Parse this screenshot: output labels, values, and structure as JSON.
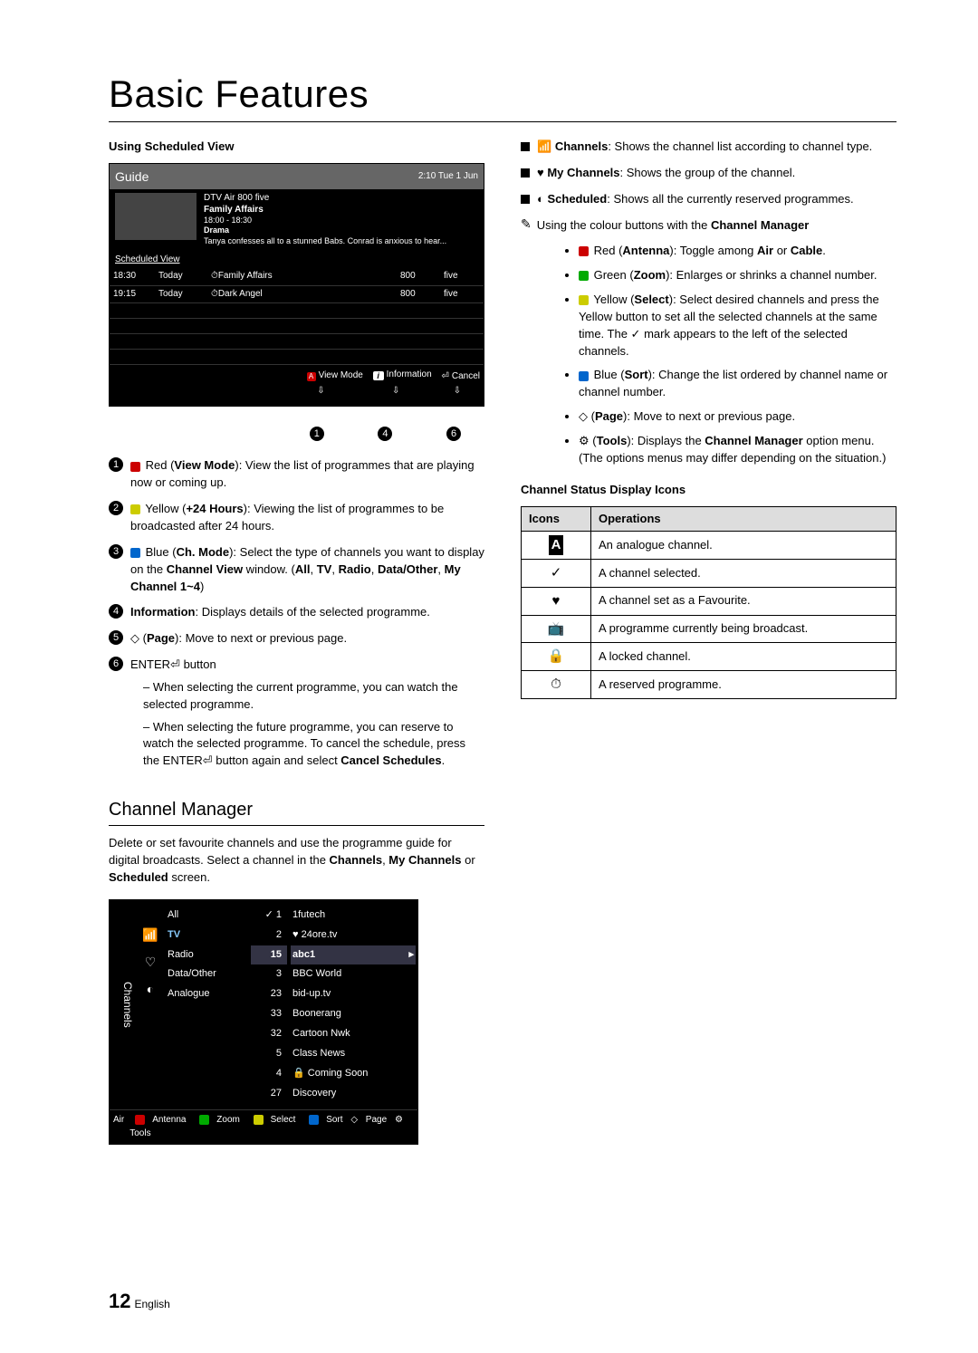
{
  "title": "Basic Features",
  "left": {
    "scheduled_view_head": "Using Scheduled View",
    "guide": {
      "title": "Guide",
      "clock": "2:10 Tue 1 Jun",
      "chan_line": "DTV Air 800 five",
      "prog_title": "Family Affairs",
      "prog_time": "18:00 - 18:30",
      "prog_genre": "Drama",
      "prog_desc": "Tanya confesses all to a stunned Babs. Conrad is anxious to hear...",
      "sched_label": "Scheduled View",
      "rows": [
        {
          "time": "18:30",
          "day": "Today",
          "title": "Family Affairs",
          "num": "800",
          "src": "five"
        },
        {
          "time": "19:15",
          "day": "Today",
          "title": "Dark Angel",
          "num": "800",
          "src": "five"
        }
      ],
      "foot_view": "View Mode",
      "foot_info": "Information",
      "foot_cancel": "Cancel",
      "callout1": "1",
      "callout4": "4",
      "callout6": "6"
    },
    "numlist": [
      {
        "n": "1",
        "pre": "Red (",
        "b": "View Mode",
        "post": "): View the list of programmes that are playing now or coming up."
      },
      {
        "n": "2",
        "pre": "Yellow (",
        "b": "+24 Hours",
        "post": "): Viewing the list of programmes to be broadcasted after 24 hours."
      },
      {
        "n": "3",
        "pre": "Blue (",
        "b": "Ch. Mode",
        "post": "): Select the type of channels you want to display on the Channel View window. (All, TV, Radio, Data/Other, My Channel 1~4)"
      },
      {
        "n": "4",
        "b": "Information",
        "post": ": Displays details of the selected programme."
      },
      {
        "n": "5",
        "pre": "◇ (",
        "b": "Page",
        "post": "): Move to next or previous page."
      },
      {
        "n": "6",
        "body": "ENTER⏎ button",
        "subs": [
          "When selecting the current programme, you can watch the selected programme.",
          "When selecting the future programme, you can reserve to watch the selected programme. To cancel the schedule, press the ENTER⏎ button again and select Cancel Schedules."
        ]
      }
    ],
    "chmgr_head": "Channel Manager",
    "chmgr_body": "Delete or set favourite channels and use the programme guide for digital broadcasts. Select a channel in the Channels, My Channels or Scheduled screen.",
    "channels_box": {
      "side": "Channels",
      "cats": [
        "All",
        "TV",
        "Radio",
        "Data/Other",
        "Analogue"
      ],
      "nums": [
        "1",
        "2",
        "15",
        "3",
        "23",
        "33",
        "32",
        "5",
        "4",
        "27"
      ],
      "names": [
        "1futech",
        "24ore.tv",
        "abc1",
        "BBC World",
        "bid-up.tv",
        "Boonerang",
        "Cartoon Nwk",
        "Class News",
        "Coming Soon",
        "Discovery"
      ],
      "foot_left": "Air",
      "foot_items": [
        "Antenna",
        "Zoom",
        "Select",
        "Sort",
        "Page",
        "Tools"
      ]
    }
  },
  "right": {
    "blk": [
      {
        "b": "Channels",
        "t": ": Shows the channel list according to channel type."
      },
      {
        "b": "My Channels",
        "t": ": Shows the group of the channel."
      },
      {
        "b": "Scheduled",
        "t": ": Shows all the currently reserved programmes."
      }
    ],
    "note_text": "Using the colour buttons with the Channel Manager",
    "colour_list": [
      {
        "c": "r",
        "b": "Red (Antenna)",
        "t": ": Toggle among Air or Cable."
      },
      {
        "c": "g",
        "b": "Green (Zoom)",
        "t": ": Enlarges or shrinks a channel number."
      },
      {
        "c": "y",
        "b": "Yellow (Select)",
        "t": ": Select desired channels and press the Yellow button to set all the selected channels at the same time. The ✓ mark appears to the left of the selected channels."
      },
      {
        "c": "b",
        "b": "Blue (Sort)",
        "t": ": Change the list ordered by channel name or channel number."
      },
      {
        "plain": true,
        "b": "◇ (Page)",
        "t": ": Move to next or previous page."
      },
      {
        "plain": true,
        "b": "⚙ (Tools)",
        "t": ": Displays the Channel Manager option menu. (The options menus may differ depending on the situation.)"
      }
    ],
    "icons_head": "Channel Status Display Icons",
    "icons_tbl_h1": "Icons",
    "icons_tbl_h2": "Operations",
    "icons_tbl": [
      {
        "i": "A",
        "t": "An analogue channel."
      },
      {
        "i": "✓",
        "t": "A channel selected."
      },
      {
        "i": "♥",
        "t": "A channel set as a Favourite."
      },
      {
        "i": "📺",
        "t": "A programme currently being broadcast."
      },
      {
        "i": "🔒",
        "t": "A locked channel."
      },
      {
        "i": "⏱",
        "t": "A reserved programme."
      }
    ]
  },
  "footer": {
    "num": "12",
    "lang": "English"
  }
}
